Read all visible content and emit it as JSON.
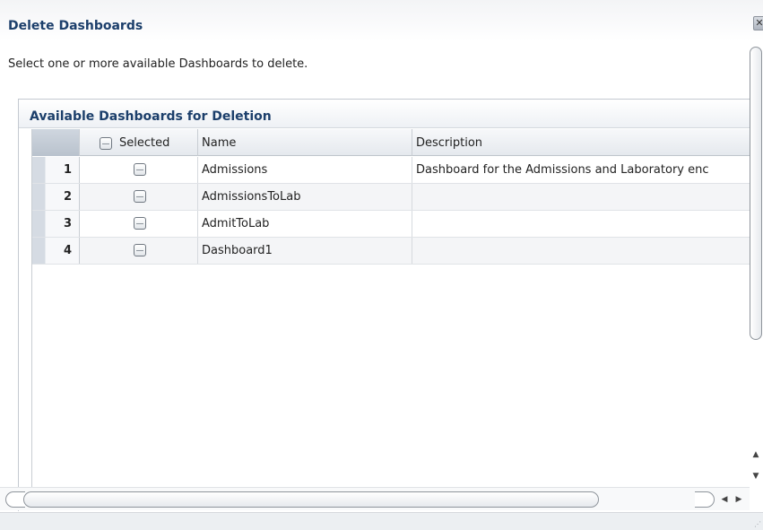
{
  "dialog": {
    "title": "Delete Dashboards",
    "close_icon": "close-icon",
    "instruction": "Select one or more available Dashboards to delete."
  },
  "panel": {
    "title": "Available Dashboards for Deletion"
  },
  "table": {
    "columns": {
      "selected": "Selected",
      "name": "Name",
      "description": "Description"
    },
    "rows": [
      {
        "num": "1",
        "name": "Admissions",
        "description": "Dashboard for the Admissions and Laboratory enc",
        "checked": false
      },
      {
        "num": "2",
        "name": "AdmissionsToLab",
        "description": "",
        "checked": false
      },
      {
        "num": "3",
        "name": "AdmitToLab",
        "description": "",
        "checked": false
      },
      {
        "num": "4",
        "name": "Dashboard1",
        "description": "",
        "checked": false
      }
    ]
  },
  "icons": {
    "scroll_up": "▲",
    "scroll_down": "▼",
    "scroll_left": "◀",
    "scroll_right": "▶",
    "close": "✕",
    "grip": "⋰"
  },
  "colors": {
    "title": "#1c3f6b",
    "row_header": "#d5dbe3"
  }
}
